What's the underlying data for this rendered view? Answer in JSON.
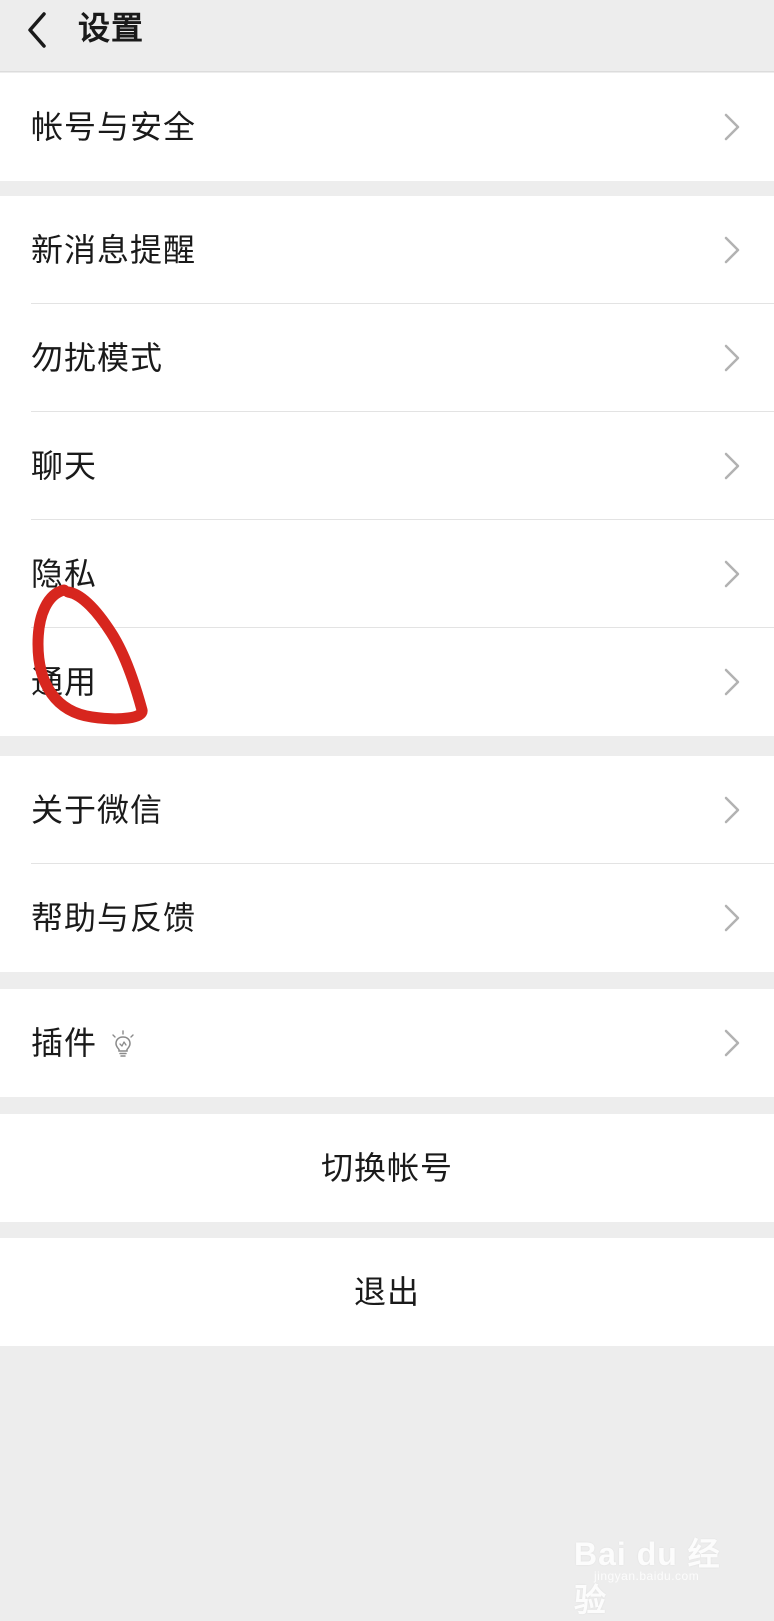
{
  "header": {
    "title": "设置",
    "back_icon": "chevron-left-icon"
  },
  "groups": [
    {
      "items": [
        {
          "label": "帐号与安全"
        }
      ]
    },
    {
      "items": [
        {
          "label": "新消息提醒"
        },
        {
          "label": "勿扰模式"
        },
        {
          "label": "聊天"
        },
        {
          "label": "隐私"
        },
        {
          "label": "通用"
        }
      ]
    },
    {
      "items": [
        {
          "label": "关于微信"
        },
        {
          "label": "帮助与反馈"
        }
      ]
    },
    {
      "items": [
        {
          "label": "插件",
          "icon": "lightbulb-icon"
        }
      ]
    }
  ],
  "actions": {
    "switch_account": "切换帐号",
    "logout": "退出"
  },
  "annotation": {
    "color": "#d7261e",
    "target": "通用"
  },
  "watermark": {
    "logo": "Bai du 经验",
    "site": "jingyan.baidu.com"
  },
  "colors": {
    "background": "#ededed",
    "card": "#ffffff",
    "chevron": "#b2b2b2"
  }
}
